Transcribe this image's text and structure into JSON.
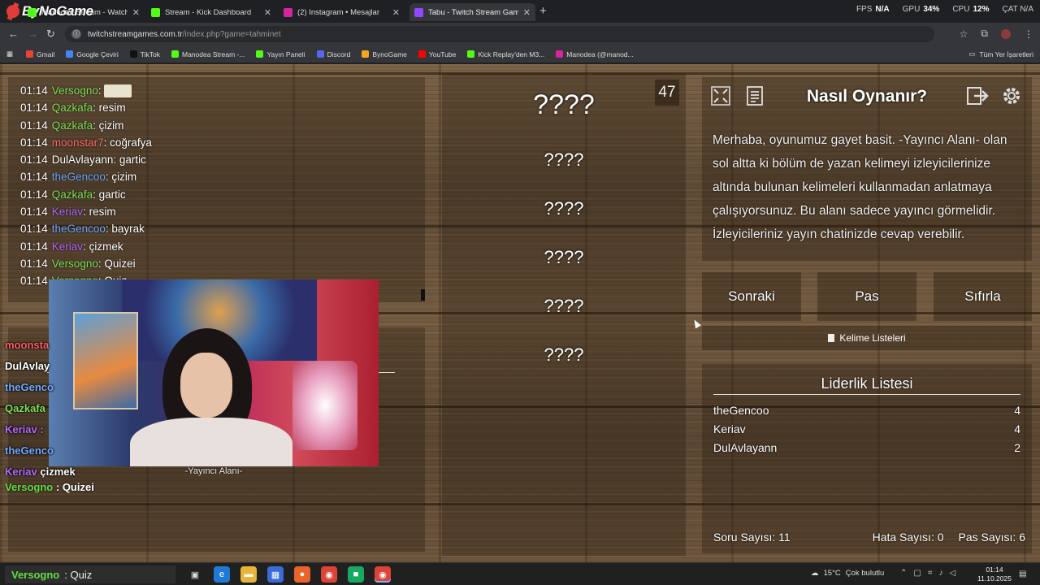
{
  "brand": {
    "logo_text": "ByNoGame"
  },
  "tabs": [
    {
      "title": "Manodea Stream - Watch Live",
      "color": "#53fc18",
      "active": false
    },
    {
      "title": "Stream - Kick Dashboard",
      "color": "#53fc18",
      "active": false
    },
    {
      "title": "(2) Instagram • Mesajlar",
      "color": "#d6249f",
      "active": false
    },
    {
      "title": "Tabu - Twitch Stream Game",
      "color": "#9146ff",
      "active": true
    }
  ],
  "stats": {
    "fps_label": "FPS",
    "fps_value": "N/A",
    "gpu_label": "GPU",
    "gpu_value": "34%",
    "cpu_label": "CPU",
    "cpu_value": "12%",
    "extra": "ÇAT N/A"
  },
  "address": {
    "host": "twitchstreamgames.com.tr",
    "path": "/index.php?game=tahminet"
  },
  "bookmarks": [
    {
      "label": "Gmail",
      "color": "#ea4335"
    },
    {
      "label": "Google Çeviri",
      "color": "#4285f4"
    },
    {
      "label": "TikTok",
      "color": "#111111"
    },
    {
      "label": "Manodea Stream -...",
      "color": "#53fc18"
    },
    {
      "label": "Yayın Paneli",
      "color": "#53fc18"
    },
    {
      "label": "Discord",
      "color": "#5865f2"
    },
    {
      "label": "BynoGame",
      "color": "#f5a623"
    },
    {
      "label": "YouTube",
      "color": "#ff0000"
    },
    {
      "label": "Kick Replay'den M3...",
      "color": "#53fc18"
    },
    {
      "label": "Manodea (@manod...",
      "color": "#d6249f"
    }
  ],
  "bookmarks_all": "Tüm Yer İşaretleri",
  "chat": {
    "messages": [
      {
        "time": "01:14",
        "user": "Versogno",
        "color": "#7ee056",
        "text": "",
        "emote": true
      },
      {
        "time": "01:14",
        "user": "Qazkafa",
        "color": "#7ee056",
        "text": "resim"
      },
      {
        "time": "01:14",
        "user": "Qazkafa",
        "color": "#7ee056",
        "text": "çizim"
      },
      {
        "time": "01:14",
        "user": "moonstar7",
        "color": "#ff6a6a",
        "text": "coğrafya"
      },
      {
        "time": "01:14",
        "user": "DulAvlayann",
        "color": "#ffffff",
        "text": "gartic"
      },
      {
        "time": "01:14",
        "user": "theGencoo",
        "color": "#6fa8ff",
        "text": "çizim"
      },
      {
        "time": "01:14",
        "user": "Qazkafa",
        "color": "#7ee056",
        "text": "gartic"
      },
      {
        "time": "01:14",
        "user": "Keriav",
        "color": "#b768ff",
        "text": "resim"
      },
      {
        "time": "01:14",
        "user": "theGencoo",
        "color": "#6fa8ff",
        "text": "bayrak"
      },
      {
        "time": "01:14",
        "user": "Keriav",
        "color": "#b768ff",
        "text": "çizmek"
      },
      {
        "time": "01:14",
        "user": "Versogno",
        "color": "#7ee056",
        "text": "Quizei"
      },
      {
        "time": "01:14",
        "user": "Versogno",
        "color": "#7ee056",
        "text": "Quiz"
      }
    ]
  },
  "overlay_chat": [
    {
      "name": "moonsta",
      "color": "#ff5a6a"
    },
    {
      "name": "DulAvlay",
      "color": "#ffffff"
    },
    {
      "name": "theGenco",
      "color": "#6fa8ff"
    },
    {
      "name": "Qazkafa",
      "color": "#7ee056"
    },
    {
      "name": "Keriav :",
      "color": "#b768ff"
    },
    {
      "name": "theGenco",
      "color": "#6fa8ff"
    },
    {
      "name": "Keriav",
      "color": "#b768ff",
      "text": "çizmek"
    }
  ],
  "overlay_last": {
    "name": "Versogno",
    "text": ": Quizei"
  },
  "streamer_caption": "-Yayıncı Alanı-",
  "counter": "47",
  "words": [
    "????",
    "????",
    "????",
    "????",
    "????",
    "????"
  ],
  "howto": {
    "title": "Nasıl Oynanır?",
    "body": "Merhaba, oyunumuz gayet basit. -Yayıncı Alanı- olan sol altta ki bölüm de yazan kelimeyi izleyicilerinize altında bulunan kelimeleri kullanmadan anlatmaya çalışıyorsunuz. Bu alanı sadece yayıncı görmelidir. İzleyicileriniz yayın chatinizde cevap verebilir."
  },
  "buttons": {
    "next": "Sonraki",
    "pass": "Pas",
    "reset": "Sıfırla"
  },
  "word_lists": "Kelime Listeleri",
  "leaderboard": {
    "title": "Liderlik Listesi",
    "rows": [
      {
        "name": "theGencoo",
        "score": "4"
      },
      {
        "name": "Keriav",
        "score": "4"
      },
      {
        "name": "DulAvlayann",
        "score": "2"
      }
    ],
    "question_count": "Soru Sayısı: 11",
    "error_count": "Hata Sayısı: 0",
    "pass_count": "Pas Sayısı: 6"
  },
  "taskbar": {
    "widget_name": "Versogno",
    "widget_text": ": Quiz",
    "weather_temp": "15°C",
    "weather_text": "Çok bulutlu",
    "time": "01:14",
    "date": "11.10.2025"
  }
}
